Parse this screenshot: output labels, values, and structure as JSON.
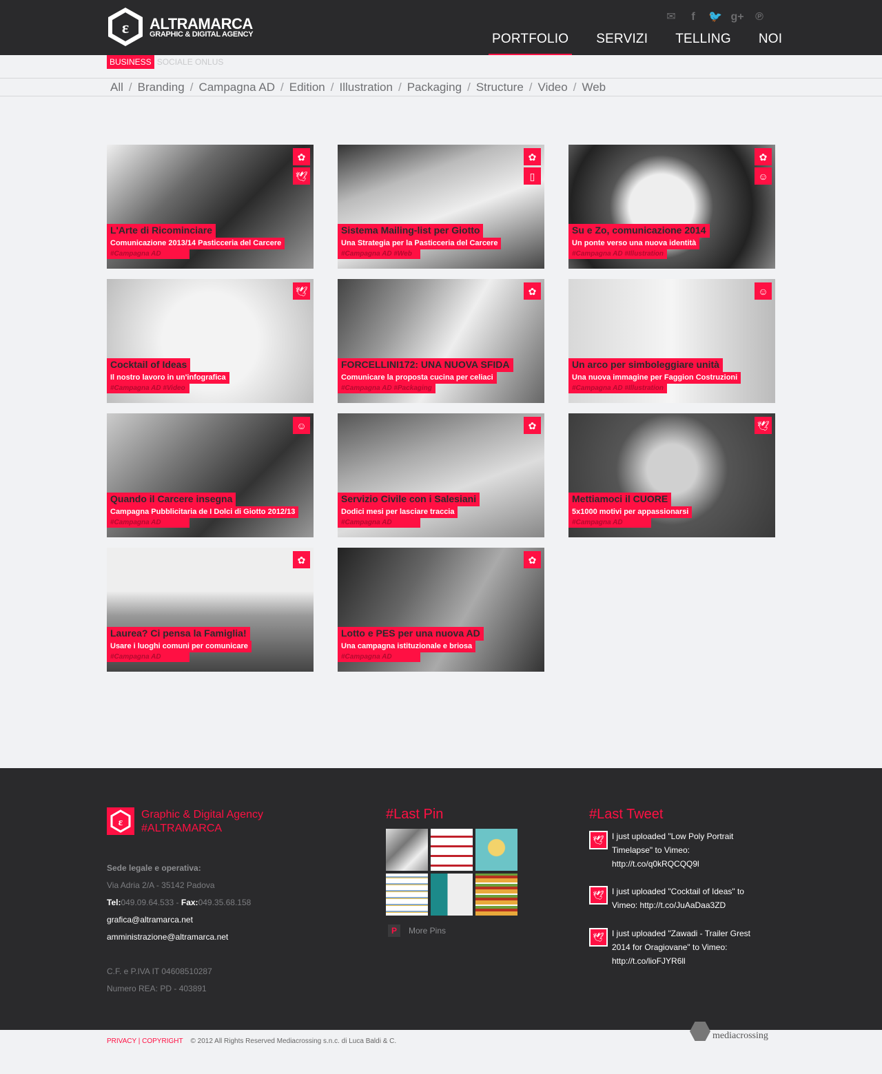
{
  "header": {
    "brand_name": "ALTRAMARCA",
    "brand_sub": "GRAPHIC & DIGITAL AGENCY",
    "nav": [
      {
        "label": "PORTFOLIO",
        "active": true
      },
      {
        "label": "SERVIZI",
        "active": false
      },
      {
        "label": "TELLING",
        "active": false
      },
      {
        "label": "NOI",
        "active": false
      }
    ],
    "social_icons": [
      "mail-icon",
      "facebook-icon",
      "twitter-icon",
      "google-plus-icon",
      "pinterest-icon"
    ]
  },
  "subnav": {
    "business": "BUSINESS",
    "sociale": "SOCIALE ONLUS"
  },
  "filters": [
    "All",
    "Branding",
    "Campagna AD",
    "Edition",
    "Illustration",
    "Packaging",
    "Structure",
    "Video",
    "Web"
  ],
  "tiles": [
    {
      "title": "L'Arte di Ricominciare",
      "subtitle": "Comunicazione 2013/14 Pasticceria del Carcere",
      "tags": "#Campagna AD",
      "icons": [
        "flower-icon",
        "bird-icon"
      ]
    },
    {
      "title": "Sistema Mailing-list per Giotto",
      "subtitle": "Una Strategia per la Pasticceria del Carcere",
      "tags": "#Campagna AD #Web",
      "icons": [
        "flower-icon",
        "tablet-icon"
      ]
    },
    {
      "title": "Su e Zo, comunicazione 2014",
      "subtitle": "Un ponte verso una nuova identità",
      "tags": "#Campagna AD #Illustration",
      "icons": [
        "flower-icon",
        "smile-icon"
      ]
    },
    {
      "title": "Cocktail of Ideas",
      "subtitle": "Il nostro lavoro in un'infografica",
      "tags": "#Campagna AD #Video",
      "icons": [
        "bird-icon"
      ]
    },
    {
      "title": "FORCELLINI172: UNA NUOVA SFIDA",
      "subtitle": "Comunicare la proposta cucina per celiaci",
      "tags": "#Campagna AD #Packaging",
      "icons": [
        "flower-icon"
      ]
    },
    {
      "title": "Un arco per simboleggiare unità",
      "subtitle": "Una nuova immagine per Faggion Costruzioni",
      "tags": "#Campagna AD #Illustration",
      "icons": [
        "smile-icon"
      ]
    },
    {
      "title": "Quando il Carcere insegna",
      "subtitle": "Campagna Pubblicitaria de I Dolci di Giotto 2012/13",
      "tags": "#Campagna AD",
      "icons": [
        "smile-icon"
      ]
    },
    {
      "title": "Servizio Civile con i Salesiani",
      "subtitle": "Dodici mesi per lasciare traccia",
      "tags": "#Campagna AD",
      "icons": [
        "flower-icon"
      ]
    },
    {
      "title": "Mettiamoci il CUORE",
      "subtitle": "5x1000 motivi per appassionarsi",
      "tags": "#Campagna AD",
      "icons": [
        "bird-icon"
      ]
    },
    {
      "title": "Laurea? Ci pensa la Famiglia!",
      "subtitle": "Usare i luoghi comuni per comunicare",
      "tags": "#Campagna AD",
      "icons": [
        "flower-icon"
      ]
    },
    {
      "title": "Lotto e PES per una nuova AD",
      "subtitle": "Una campagna istituzionale e briosa",
      "tags": "#Campagna AD",
      "icons": [
        "flower-icon"
      ]
    }
  ],
  "footer": {
    "tagline_1": "Graphic & Digital Agency",
    "tagline_2": "#ALTRAMARCA",
    "sede_label": "Sede legale e operativa:",
    "address": "Via Adria 2/A - 35142 Padova",
    "tel_label": "Tel:",
    "tel": "049.09.64.533",
    "fax_label": "Fax:",
    "fax": "049.35.68.158",
    "email_1": "grafica@altramarca.net",
    "email_2": "amministrazione@altramarca.net",
    "cf": "C.F. e P.IVA IT 04608510287",
    "rea": "Numero REA: PD - 403891",
    "pins_heading": "#Last Pin",
    "more_pins": "More Pins",
    "tweets_heading": "#Last Tweet",
    "tweets": [
      "I just uploaded \"Low Poly Portrait Timelapse\" to Vimeo: http://t.co/q0kRQCQQ9l",
      "I just uploaded \"Cocktail of Ideas\" to Vimeo: http://t.co/JuAaDaa3ZD",
      "I just uploaded \"Zawadi - Trailer Grest 2014 for Oragiovane\" to Vimeo: http://t.co/lioFJYR6ll"
    ]
  },
  "bottom": {
    "privacy": "PRIVACY | COPYRIGHT",
    "copyright": "© 2012 All Rights Reserved Mediacrossing s.n.c. di Luca Baldi & C.",
    "partner": "mediacrossing"
  },
  "colors": {
    "accent": "#ff1043",
    "dark": "#2a2a2c",
    "background": "#f1f2f4"
  }
}
